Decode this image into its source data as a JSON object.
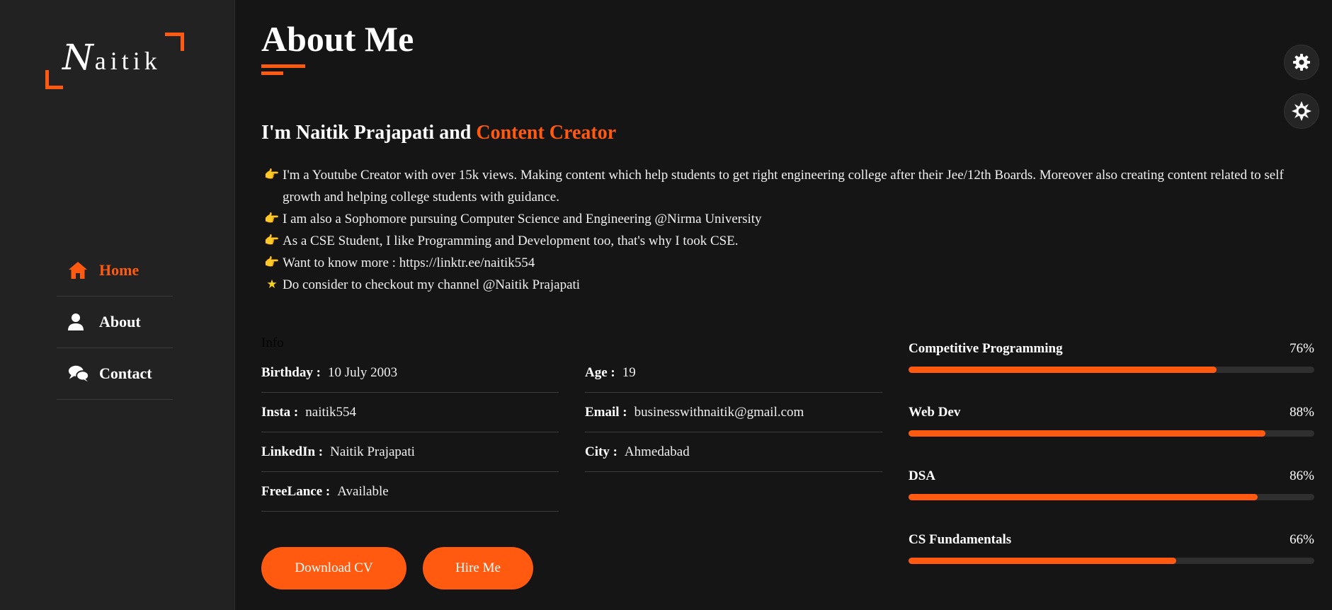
{
  "sidebar": {
    "logo": {
      "initial": "N",
      "rest": "aitik"
    },
    "items": [
      {
        "label": "Home",
        "icon": "home-icon",
        "active": true
      },
      {
        "label": "About",
        "icon": "user-icon",
        "active": false
      },
      {
        "label": "Contact",
        "icon": "chat-icon",
        "active": false
      }
    ]
  },
  "main": {
    "title": "About Me",
    "intro": {
      "prefix": "I'm Naitik Prajapati and ",
      "highlight": "Content Creator"
    },
    "bio": [
      {
        "icon": "pointing-hand-icon",
        "glyph": "👉",
        "text": "I'm a Youtube Creator with over 15k views. Making content which help students to get right engineering college after their Jee/12th Boards. Moreover also creating content related to self growth and helping college students with guidance."
      },
      {
        "icon": "pointing-hand-icon",
        "glyph": "👉",
        "text": "I am also a Sophomore pursuing Computer Science and Engineering @Nirma University"
      },
      {
        "icon": "pointing-hand-icon",
        "glyph": "👉",
        "text": "As a CSE Student, I like Programming and Development too, that's why I took CSE."
      },
      {
        "icon": "pointing-hand-icon",
        "glyph": "👉",
        "text": "Want to know more : https://linktr.ee/naitik554"
      },
      {
        "icon": "star-icon",
        "glyph": "★",
        "text": "Do consider to checkout my channel @Naitik Prajapati"
      }
    ],
    "info_label": "Info",
    "info_left": [
      {
        "key": "Birthday :",
        "value": "10 July 2003"
      },
      {
        "key": "Insta :",
        "value": "naitik554"
      },
      {
        "key": "LinkedIn :",
        "value": "Naitik Prajapati"
      },
      {
        "key": "FreeLance :",
        "value": "Available"
      }
    ],
    "info_right": [
      {
        "key": "Age :",
        "value": "19"
      },
      {
        "key": "Email :",
        "value": "businesswithnaitik@gmail.com"
      },
      {
        "key": "City :",
        "value": "Ahmedabad"
      }
    ],
    "buttons": {
      "download_cv": "Download CV",
      "hire_me": "Hire Me"
    },
    "skills": [
      {
        "name": "Competitive Programming",
        "percent_label": "76%",
        "value": 0.76
      },
      {
        "name": "Web Dev",
        "percent_label": "88%",
        "value": 0.88
      },
      {
        "name": "DSA",
        "percent_label": "86%",
        "value": 0.86
      },
      {
        "name": "CS Fundamentals",
        "percent_label": "66%",
        "value": 0.66
      }
    ]
  },
  "controls": [
    {
      "icon": "gear-icon"
    },
    {
      "icon": "sun-icon"
    }
  ],
  "colors": {
    "accent": "#ff5a10",
    "background": "#151515",
    "sidebar": "#222222"
  }
}
